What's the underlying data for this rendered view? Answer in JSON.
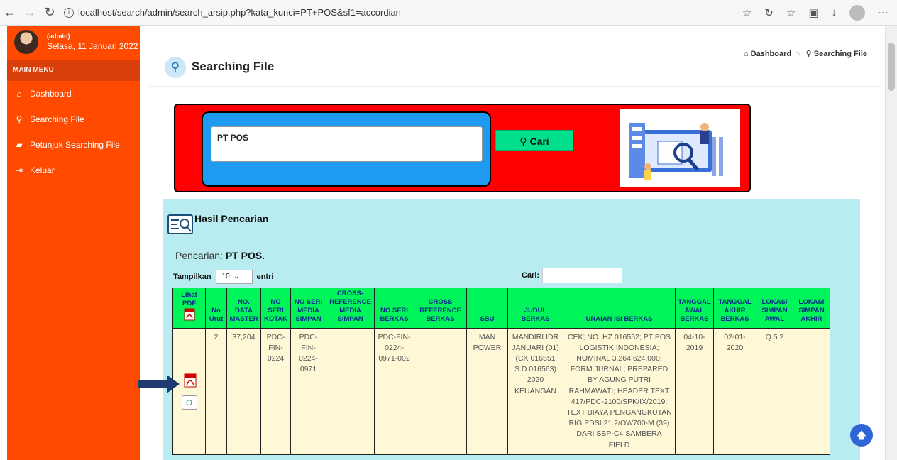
{
  "browser": {
    "url": "localhost/search/admin/search_arsip.php?kata_kunci=PT+POS&sf1=accordian"
  },
  "sidebar": {
    "user_role": "(admin)",
    "user_date": "Selasa, 11 Januari 2022",
    "menu_header": "MAIN MENU",
    "items": [
      {
        "label": "Dashboard",
        "icon": "home-icon"
      },
      {
        "label": "Searching File",
        "icon": "search-icon"
      },
      {
        "label": "Petunjuk Searching File",
        "icon": "book-icon"
      },
      {
        "label": "Keluar",
        "icon": "logout-icon"
      }
    ]
  },
  "page": {
    "title": "Searching File",
    "breadcrumb_home": "Dashboard",
    "breadcrumb_current": "Searching File"
  },
  "search": {
    "value": "PT POS",
    "button_label": "Cari"
  },
  "results": {
    "title": "Hasil Pencarian",
    "query_label": "Pencarian:",
    "query_value": "PT POS.",
    "length_label": "Tampilkan",
    "length_value": "10",
    "length_suffix": "entri",
    "filter_label": "Cari:",
    "headers": [
      "Lihat PDF",
      "No Urut",
      "NO. DATA MASTER",
      "NO SERI KOTAK",
      "NO SERI MEDIA SIMPAN",
      "CROSS-REFERENCE MEDIA SIMPAN",
      "NO SERI BERKAS",
      "CROSS REFERENCE BERKAS",
      "SBU",
      "JUDUL BERKAS",
      "URAIAN ISI BERKAS",
      "TANGGAL AWAL BERKAS",
      "TANGGAL AKHIR BERKAS",
      "LOKASI SIMPAN AWAL",
      "LOKASI SIMPAN AKHIR"
    ],
    "row": {
      "no_urut": "2",
      "no_data_master": "37,204",
      "no_seri_kotak": "PDC-FIN-0224",
      "no_seri_media": "PDC-FIN-0224-0971",
      "cross_ref_media": "",
      "no_seri_berkas": "PDC-FIN-0224-0971-002",
      "cross_ref_berkas": "",
      "sbu": "MAN POWER",
      "judul": "MANDIRI IDR JANUARI (01) (CK 016551 S.D.016563) 2020 KEUANGAN",
      "uraian": "CEK; NO. HZ 016552; PT POS LOGISTIK INDONESIA; NOMINAL 3.264.624.000; FORM JURNAL; PREPARED BY AGUNG PUTRI RAHMAWATI; HEADER TEXT 417/PDC-2100/SPK/IX/2019; TEXT BIAYA PENGANGKUTAN RIG PDSI 21.2/OW700-M (39) DARI SBP-C4 SAMBERA FIELD",
      "tgl_awal": "04-10-2019",
      "tgl_akhir": "02-01-2020",
      "lokasi_awal": "Q.5.2",
      "lokasi_akhir": ""
    }
  }
}
